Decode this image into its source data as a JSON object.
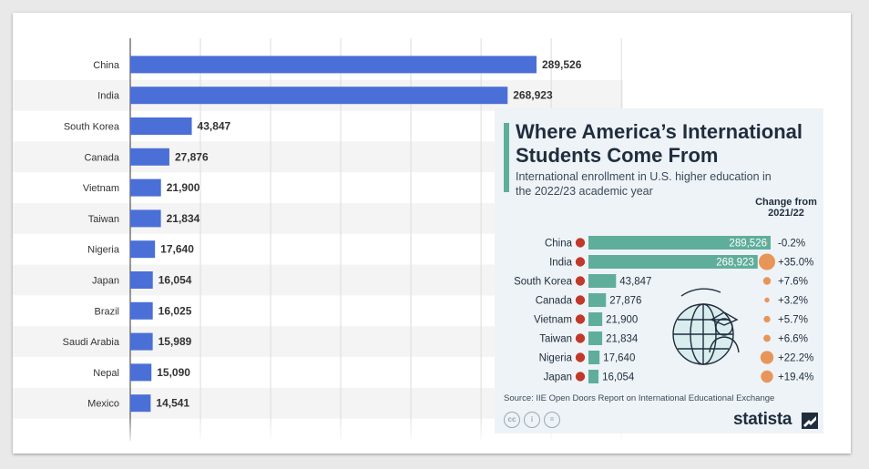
{
  "chart_data": [
    {
      "type": "bar",
      "orientation": "horizontal",
      "categories": [
        "China",
        "India",
        "South Korea",
        "Canada",
        "Vietnam",
        "Taiwan",
        "Nigeria",
        "Japan",
        "Brazil",
        "Saudi Arabia",
        "Nepal",
        "Mexico"
      ],
      "values": [
        289526,
        268923,
        43847,
        27876,
        21900,
        21834,
        17640,
        16054,
        16025,
        15989,
        15090,
        14541
      ],
      "value_labels": [
        "289,526",
        "268,923",
        "43,847",
        "27,876",
        "21,900",
        "21,834",
        "17,640",
        "16,054",
        "16,025",
        "15,989",
        "15,090",
        "14,541"
      ],
      "xlim": [
        0,
        350000
      ],
      "grid": true,
      "bar_color": "#4a6fd6"
    },
    {
      "type": "bar",
      "orientation": "horizontal",
      "title": "Where America’s International Students Come From",
      "subtitle": "International enrollment in U.S. higher education in the 2022/23 academic year",
      "change_header": "Change from 2021/22",
      "categories": [
        "China",
        "India",
        "South Korea",
        "Canada",
        "Vietnam",
        "Taiwan",
        "Nigeria",
        "Japan"
      ],
      "flag_icons": [
        "flag-china-icon",
        "flag-india-icon",
        "flag-south-korea-icon",
        "flag-canada-icon",
        "flag-vietnam-icon",
        "flag-taiwan-icon",
        "flag-nigeria-icon",
        "flag-japan-icon"
      ],
      "values": [
        289526,
        268923,
        43847,
        27876,
        21900,
        21834,
        17640,
        16054
      ],
      "value_labels": [
        "289,526",
        "268,923",
        "43,847",
        "27,876",
        "21,900",
        "21,834",
        "17,640",
        "16,054"
      ],
      "change_percent": [
        -0.2,
        35.0,
        7.6,
        3.2,
        5.7,
        6.6,
        22.2,
        19.4
      ],
      "change_labels": [
        "-0.2%",
        "+35.0%",
        "+7.6%",
        "+3.2%",
        "+5.7%",
        "+6.6%",
        "+22.2%",
        "+19.4%"
      ],
      "bar_color": "#5fae9b",
      "bubble_color": "#e8955a",
      "source": "Source: IIE Open Doors Report on International Educational Exchange",
      "brand": "statista"
    }
  ],
  "card_icons": [
    "globe-graduate-icon",
    "cc-icon",
    "attribution-icon",
    "no-derivatives-icon",
    "statista-logo-icon"
  ],
  "cc_marks": [
    "cc",
    "i",
    "="
  ]
}
